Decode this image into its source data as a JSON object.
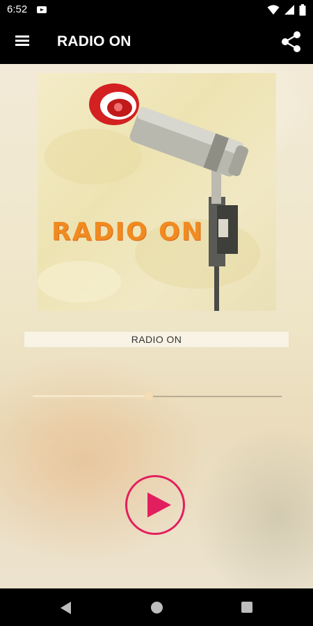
{
  "status_bar": {
    "time": "6:52",
    "icons": [
      "notification-icon",
      "wifi-icon",
      "signal-icon",
      "battery-icon"
    ]
  },
  "app_bar": {
    "title": "RADIO ON",
    "left_icon": "menu-icon",
    "right_icon": "share-icon"
  },
  "album_art": {
    "logo_text": "RADIO ON"
  },
  "player": {
    "station_name": "RADIO ON",
    "volume_fraction": 0.465,
    "play_icon": "play-icon",
    "accent_color": "#e21f5e"
  },
  "nav_bar": {
    "buttons": [
      "back-icon",
      "home-icon",
      "recents-icon"
    ]
  }
}
